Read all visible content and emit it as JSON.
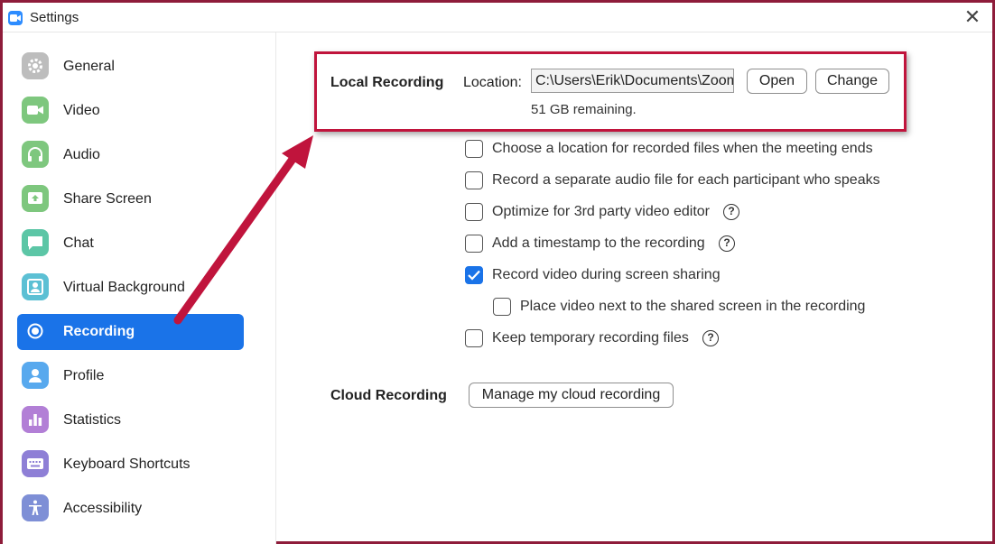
{
  "window": {
    "title": "Settings"
  },
  "icons": {
    "app": "zoom-camera-icon",
    "close": "close-icon",
    "help": "question-circle-icon"
  },
  "colors": {
    "accent": "#1a73e8",
    "frame": "#8e1c3a",
    "annotation": "#c0143c"
  },
  "sidebar": {
    "items": [
      {
        "label": "General",
        "icon": "gear-icon",
        "color": "#b8b8b8"
      },
      {
        "label": "Video",
        "icon": "video-camera-icon",
        "color": "#7ec77e"
      },
      {
        "label": "Audio",
        "icon": "headphones-icon",
        "color": "#7ec77e"
      },
      {
        "label": "Share Screen",
        "icon": "share-screen-icon",
        "color": "#7ec77e"
      },
      {
        "label": "Chat",
        "icon": "chat-bubble-icon",
        "color": "#5cc6a6"
      },
      {
        "label": "Virtual Background",
        "icon": "person-portrait-icon",
        "color": "#5cc0d4"
      },
      {
        "label": "Recording",
        "icon": "record-icon",
        "color": "#1a73e8",
        "active": true
      },
      {
        "label": "Profile",
        "icon": "person-icon",
        "color": "#58a9ee"
      },
      {
        "label": "Statistics",
        "icon": "bar-chart-icon",
        "color": "#b27fd6"
      },
      {
        "label": "Keyboard Shortcuts",
        "icon": "keyboard-icon",
        "color": "#8e7fd6"
      },
      {
        "label": "Accessibility",
        "icon": "accessibility-icon",
        "color": "#7e8fd6"
      }
    ]
  },
  "local_recording": {
    "title": "Local Recording",
    "location_label": "Location:",
    "location_value": "C:\\Users\\Erik\\Documents\\Zoom",
    "open_label": "Open",
    "change_label": "Change",
    "remaining": "51 GB remaining."
  },
  "options": [
    {
      "label": "Choose a location for recorded files when the meeting ends",
      "checked": false,
      "help": false
    },
    {
      "label": "Record a separate audio file for each participant who speaks",
      "checked": false,
      "help": false
    },
    {
      "label": "Optimize for 3rd party video editor",
      "checked": false,
      "help": true
    },
    {
      "label": "Add a timestamp to the recording",
      "checked": false,
      "help": true
    },
    {
      "label": "Record video during screen sharing",
      "checked": true,
      "help": false
    },
    {
      "label": "Place video next to the shared screen in the recording",
      "checked": false,
      "help": false,
      "indent": true
    },
    {
      "label": "Keep temporary recording files",
      "checked": false,
      "help": true
    }
  ],
  "cloud_recording": {
    "title": "Cloud Recording",
    "manage_label": "Manage my cloud recording"
  },
  "help_glyph": "?"
}
